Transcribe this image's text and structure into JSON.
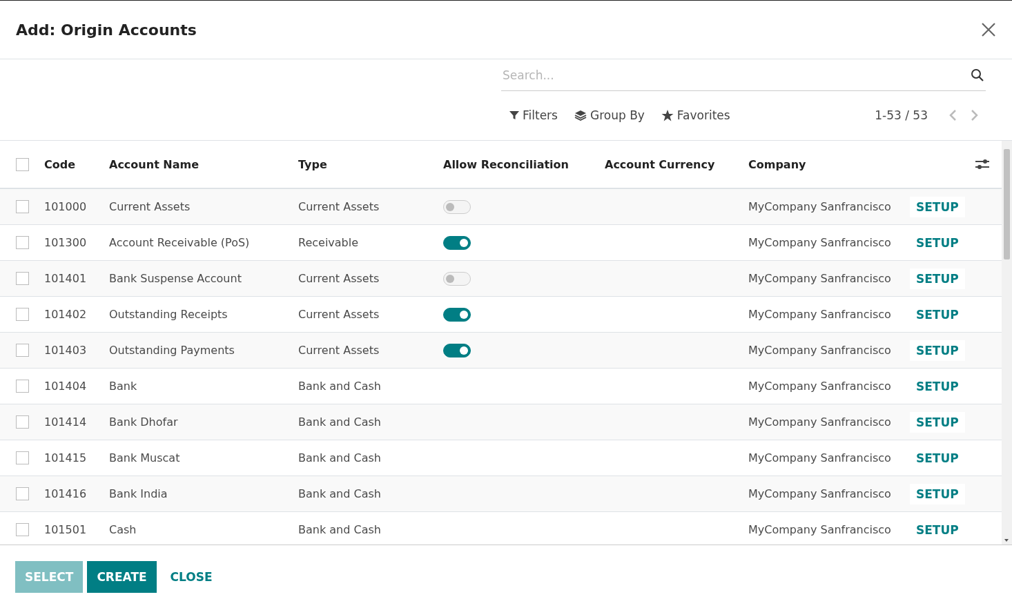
{
  "dialog": {
    "title": "Add: Origin Accounts"
  },
  "search": {
    "placeholder": "Search..."
  },
  "toolbar": {
    "filters": "Filters",
    "group_by": "Group By",
    "favorites": "Favorites",
    "pager": "1-53 / 53"
  },
  "table": {
    "header_checked": false,
    "columns": [
      "Code",
      "Account Name",
      "Type",
      "Allow Reconciliation",
      "Account Currency",
      "Company"
    ],
    "rows": [
      {
        "checked": false,
        "code": "101000",
        "name": "Current Assets",
        "type": "Current Assets",
        "reconcile": false,
        "company": "MyCompany Sanfrancisco",
        "action": "SETUP"
      },
      {
        "checked": false,
        "code": "101300",
        "name": "Account Receivable (PoS)",
        "type": "Receivable",
        "reconcile": true,
        "company": "MyCompany Sanfrancisco",
        "action": "SETUP"
      },
      {
        "checked": false,
        "code": "101401",
        "name": "Bank Suspense Account",
        "type": "Current Assets",
        "reconcile": false,
        "company": "MyCompany Sanfrancisco",
        "action": "SETUP"
      },
      {
        "checked": false,
        "code": "101402",
        "name": "Outstanding Receipts",
        "type": "Current Assets",
        "reconcile": true,
        "company": "MyCompany Sanfrancisco",
        "action": "SETUP"
      },
      {
        "checked": false,
        "code": "101403",
        "name": "Outstanding Payments",
        "type": "Current Assets",
        "reconcile": true,
        "company": "MyCompany Sanfrancisco",
        "action": "SETUP"
      },
      {
        "checked": false,
        "code": "101404",
        "name": "Bank",
        "type": "Bank and Cash",
        "company": "MyCompany Sanfrancisco",
        "action": "SETUP"
      },
      {
        "checked": false,
        "code": "101414",
        "name": "Bank Dhofar",
        "type": "Bank and Cash",
        "company": "MyCompany Sanfrancisco",
        "action": "SETUP"
      },
      {
        "checked": false,
        "code": "101415",
        "name": "Bank Muscat",
        "type": "Bank and Cash",
        "company": "MyCompany Sanfrancisco",
        "action": "SETUP"
      },
      {
        "checked": false,
        "code": "101416",
        "name": "Bank India",
        "type": "Bank and Cash",
        "company": "MyCompany Sanfrancisco",
        "action": "SETUP"
      },
      {
        "checked": false,
        "code": "101501",
        "name": "Cash",
        "type": "Bank and Cash",
        "company": "MyCompany Sanfrancisco",
        "action": "SETUP"
      }
    ]
  },
  "footer": {
    "buttons": [
      {
        "label": "SELECT",
        "kind": "primary",
        "disabled": true
      },
      {
        "label": "CREATE",
        "kind": "primary",
        "disabled": false
      },
      {
        "label": "CLOSE",
        "kind": "link",
        "disabled": false
      }
    ]
  }
}
